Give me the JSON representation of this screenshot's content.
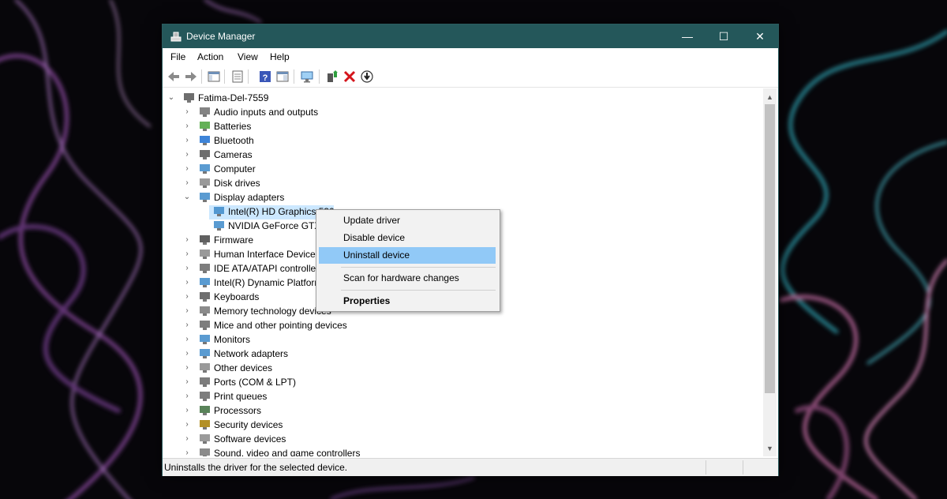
{
  "window": {
    "title": "Device Manager",
    "minimize_glyph": "—",
    "maximize_glyph": "☐",
    "close_glyph": "✕"
  },
  "menubar": [
    "File",
    "Action",
    "View",
    "Help"
  ],
  "toolbar": {
    "icons": [
      "back-icon",
      "forward-icon",
      "show-hide-console-tree-icon",
      "properties-icon",
      "help-icon",
      "show-action-pane-icon",
      "scan-hardware-icon",
      "add-driver-icon",
      "uninstall-icon",
      "update-driver-icon"
    ]
  },
  "tree": {
    "root": "Fatima-Del-7559",
    "categories": [
      "Audio inputs and outputs",
      "Batteries",
      "Bluetooth",
      "Cameras",
      "Computer",
      "Disk drives",
      "Display adapters",
      "Intel(R) HD Graphics 530",
      "NVIDIA GeForce GTX",
      "Firmware",
      "Human Interface Devices",
      "IDE ATA/ATAPI controllers",
      "Intel(R) Dynamic Platform",
      "Keyboards",
      "Memory technology devices",
      "Mice and other pointing devices",
      "Monitors",
      "Network adapters",
      "Other devices",
      "Ports (COM & LPT)",
      "Print queues",
      "Processors",
      "Security devices",
      "Software devices",
      "Sound, video and game controllers"
    ],
    "expanded": "Display adapters",
    "selected": "Intel(R) HD Graphics 530"
  },
  "context_menu": {
    "items": [
      "Update driver",
      "Disable device",
      "Uninstall device",
      "Scan for hardware changes",
      "Properties"
    ],
    "highlighted": "Uninstall device"
  },
  "status": {
    "text": "Uninstalls the driver for the selected device."
  },
  "colors": {
    "titlebar": "#24575a",
    "menu_highlight": "#91c9f7",
    "selection": "#cce8ff"
  }
}
